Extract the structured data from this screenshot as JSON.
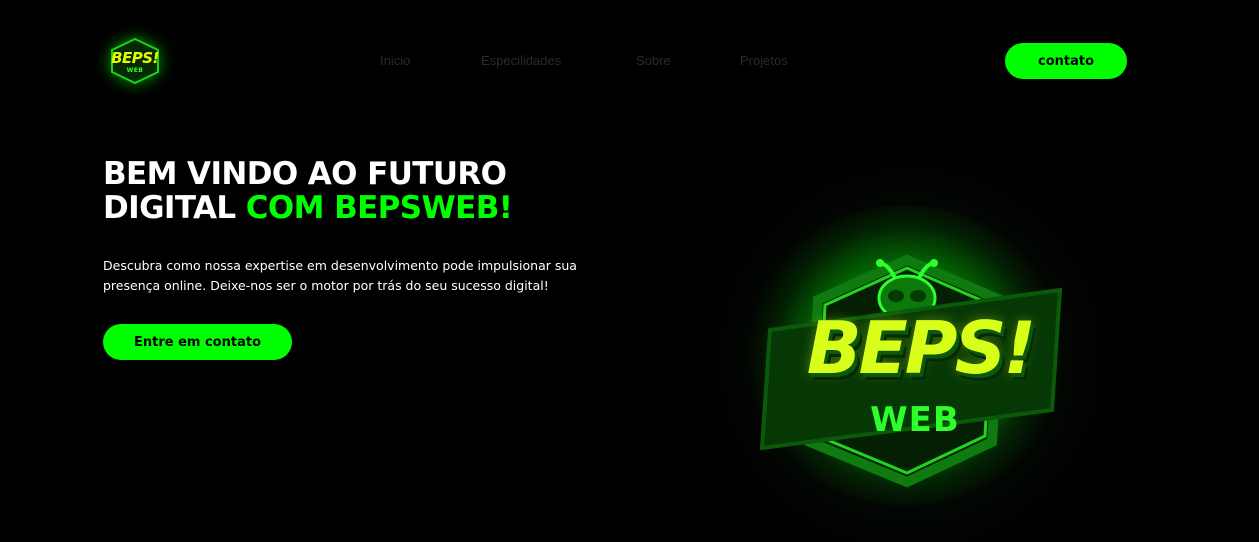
{
  "brand": {
    "logo_text": "BEPS!",
    "logo_sub": "WEB",
    "accent_color": "#00ff00"
  },
  "nav": {
    "items": [
      {
        "label": "Inicio"
      },
      {
        "label": "Especilidades"
      },
      {
        "label": "Sobre"
      },
      {
        "label": "Projetos"
      }
    ],
    "contact_label": "contato"
  },
  "hero": {
    "title_line1": "BEM VINDO AO FUTURO",
    "title_line2_plain": "DIGITAL ",
    "title_line2_accent": "COM BEPSWEB!",
    "description_line1": "Descubra como nossa expertise em desenvolvimento pode impulsionar sua",
    "description_line2": "presença online. Deixe-nos ser o motor por trás do seu sucesso digital!",
    "cta_label": "Entre em contato"
  },
  "hero_logo": {
    "main_text": "BEPS!",
    "sub_text": "WEB"
  }
}
